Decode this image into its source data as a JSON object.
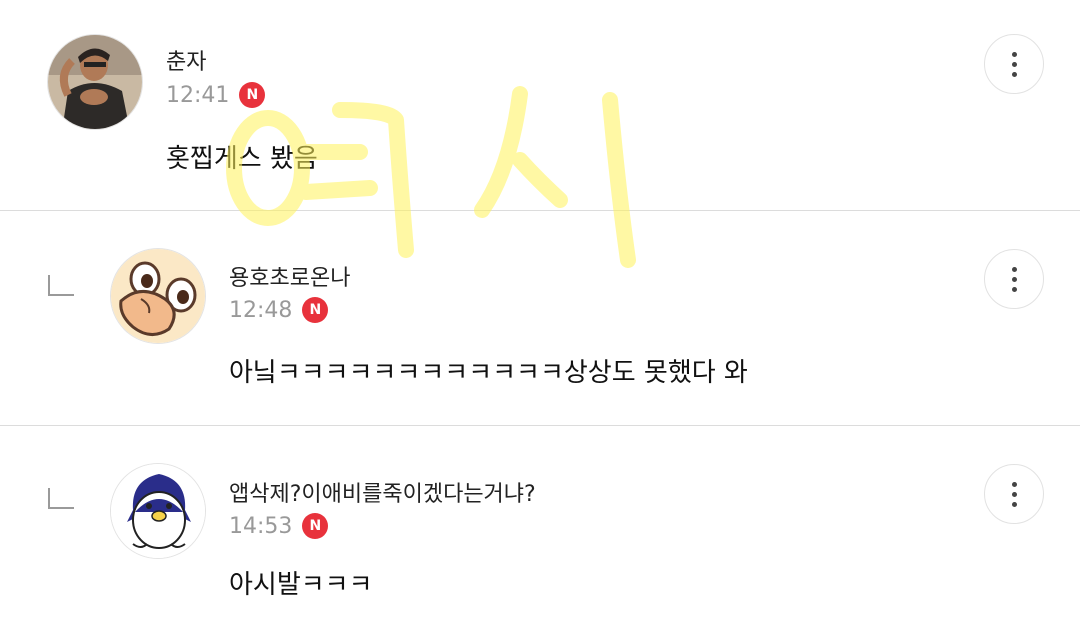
{
  "comments": [
    {
      "author": "춘자",
      "time": "12:41",
      "badge": "N",
      "text": "홋찝게스 봤음",
      "avatar_icon": "woman-photo-avatar",
      "is_reply": false
    },
    {
      "author": "용호초로온나",
      "time": "12:48",
      "badge": "N",
      "text": "아닠ㅋㅋㅋㅋㅋㅋㅋㅋㅋㅋㅋㅋ상상도 못했다 와",
      "avatar_icon": "cartoon-duck-avatar",
      "is_reply": true
    },
    {
      "author": "앱삭제?이애비를죽이겠다는거냐?",
      "time": "14:53",
      "badge": "N",
      "text": "아시발ㅋㅋㅋ",
      "avatar_icon": "cartoon-penguin-avatar",
      "is_reply": true
    }
  ],
  "watermark_color": "#fff35a",
  "badge_color": "#e8323c"
}
